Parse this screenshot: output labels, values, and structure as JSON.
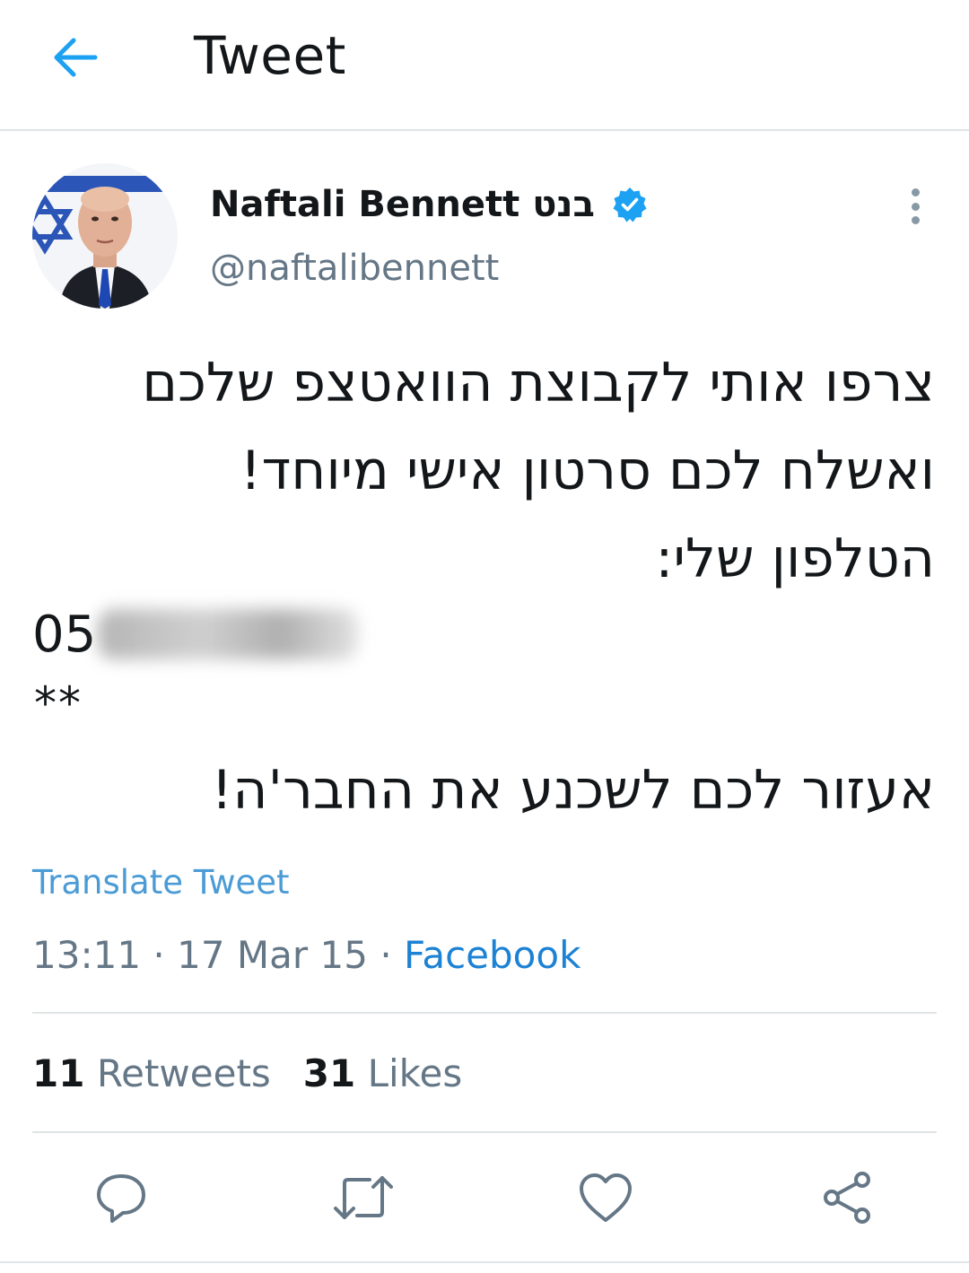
{
  "header": {
    "title": "Tweet",
    "back_icon": "back-arrow-icon"
  },
  "tweet": {
    "author": {
      "display_name": "Naftali Bennett בנט",
      "handle": "@naftalibennett",
      "verified": true
    },
    "body_lines": [
      "צרפו אותי לקבוצת הוואטצפ שלכם",
      "ואשלח לכם סרטון אישי מיוחד!",
      "הטלפון שלי:"
    ],
    "phone_prefix": "05",
    "phone_redacted": true,
    "stars": "**",
    "closing_line": "אעזור לכם לשכנע את החבר'ה!",
    "translate_label": "Translate Tweet",
    "time": "13:11",
    "date": "17 Mar 15",
    "separator": "·",
    "source": "Facebook",
    "retweet_count": "11",
    "retweet_label": "Retweets",
    "like_count": "31",
    "like_label": "Likes"
  },
  "actions": [
    "reply-icon",
    "retweet-icon",
    "like-icon",
    "share-icon"
  ],
  "colors": {
    "accent": "#1da1f2",
    "link": "#4a9bd6",
    "secondary_text": "#657786",
    "divider": "#e1e4e6"
  }
}
